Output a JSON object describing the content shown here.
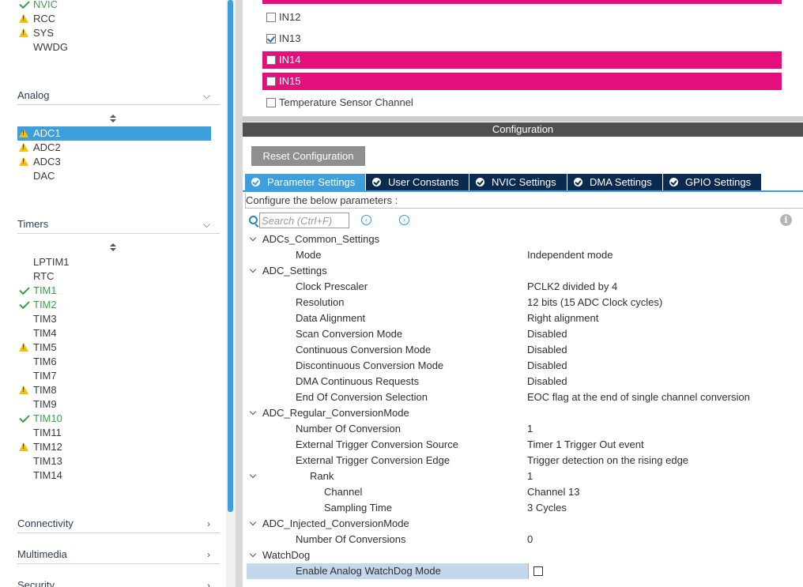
{
  "sidebar": {
    "top_items": [
      {
        "label": "NVIC",
        "status": "ok"
      },
      {
        "label": "RCC",
        "status": "warning"
      },
      {
        "label": "SYS",
        "status": "warning"
      },
      {
        "label": "WWDG",
        "status": "none"
      }
    ],
    "analog": {
      "title": "Analog",
      "items": [
        {
          "label": "ADC1",
          "status": "warning",
          "selected": true
        },
        {
          "label": "ADC2",
          "status": "warning"
        },
        {
          "label": "ADC3",
          "status": "warning"
        },
        {
          "label": "DAC",
          "status": "none"
        }
      ]
    },
    "timers": {
      "title": "Timers",
      "items": [
        {
          "label": "LPTIM1",
          "status": "none"
        },
        {
          "label": "RTC",
          "status": "none"
        },
        {
          "label": "TIM1",
          "status": "ok"
        },
        {
          "label": "TIM2",
          "status": "ok"
        },
        {
          "label": "TIM3",
          "status": "none"
        },
        {
          "label": "TIM4",
          "status": "none"
        },
        {
          "label": "TIM5",
          "status": "warning"
        },
        {
          "label": "TIM6",
          "status": "none"
        },
        {
          "label": "TIM7",
          "status": "none"
        },
        {
          "label": "TIM8",
          "status": "warning"
        },
        {
          "label": "TIM9",
          "status": "none"
        },
        {
          "label": "TIM10",
          "status": "ok"
        },
        {
          "label": "TIM11",
          "status": "none"
        },
        {
          "label": "TIM12",
          "status": "warning"
        },
        {
          "label": "TIM13",
          "status": "none"
        },
        {
          "label": "TIM14",
          "status": "none"
        }
      ]
    },
    "categories": {
      "connectivity": "Connectivity",
      "multimedia": "Multimedia",
      "security": "Security"
    }
  },
  "channels": [
    {
      "label": "IN12",
      "checked": false,
      "highlight": false
    },
    {
      "label": "IN13",
      "checked": true,
      "highlight": false
    },
    {
      "label": "IN14",
      "checked": false,
      "highlight": true
    },
    {
      "label": "IN15",
      "checked": false,
      "highlight": true
    },
    {
      "label": "Temperature Sensor Channel",
      "checked": false,
      "highlight": false
    }
  ],
  "config": {
    "header": "Configuration",
    "reset_label": "Reset Configuration",
    "tabs": [
      {
        "label": "Parameter Settings",
        "active": true
      },
      {
        "label": "User Constants",
        "active": false
      },
      {
        "label": "NVIC Settings",
        "active": false
      },
      {
        "label": "DMA Settings",
        "active": false
      },
      {
        "label": "GPIO Settings",
        "active": false
      }
    ],
    "hint": "Configure the below parameters :",
    "search_placeholder": "Search (Ctrl+F)"
  },
  "params": [
    {
      "type": "group",
      "name": "ADCs_Common_Settings"
    },
    {
      "type": "param",
      "name": "Mode",
      "value": "Independent mode"
    },
    {
      "type": "group",
      "name": "ADC_Settings"
    },
    {
      "type": "param",
      "name": "Clock Prescaler",
      "value": "PCLK2 divided by 4"
    },
    {
      "type": "param",
      "name": "Resolution",
      "value": "12 bits (15 ADC Clock cycles)"
    },
    {
      "type": "param",
      "name": "Data Alignment",
      "value": "Right alignment"
    },
    {
      "type": "param",
      "name": "Scan Conversion Mode",
      "value": "Disabled"
    },
    {
      "type": "param",
      "name": "Continuous Conversion Mode",
      "value": "Disabled"
    },
    {
      "type": "param",
      "name": "Discontinuous Conversion Mode",
      "value": "Disabled"
    },
    {
      "type": "param",
      "name": "DMA Continuous Requests",
      "value": "Disabled"
    },
    {
      "type": "param",
      "name": "End Of Conversion Selection",
      "value": "EOC flag at the end of single channel conversion"
    },
    {
      "type": "group",
      "name": "ADC_Regular_ConversionMode"
    },
    {
      "type": "param",
      "name": "Number Of Conversion",
      "value": "1"
    },
    {
      "type": "param",
      "name": "External Trigger Conversion Source",
      "value": "Timer 1 Trigger Out event"
    },
    {
      "type": "param",
      "name": "External Trigger Conversion Edge",
      "value": "Trigger detection on the rising edge"
    },
    {
      "type": "subgroup",
      "name": "Rank",
      "value": "1"
    },
    {
      "type": "subparam",
      "name": "Channel",
      "value": "Channel 13"
    },
    {
      "type": "subparam",
      "name": "Sampling Time",
      "value": "3 Cycles"
    },
    {
      "type": "group",
      "name": "ADC_Injected_ConversionMode"
    },
    {
      "type": "param",
      "name": "Number Of Conversions",
      "value": "0"
    },
    {
      "type": "group",
      "name": "WatchDog"
    },
    {
      "type": "checkbox",
      "name": "Enable Analog WatchDog Mode",
      "checked": false
    }
  ]
}
